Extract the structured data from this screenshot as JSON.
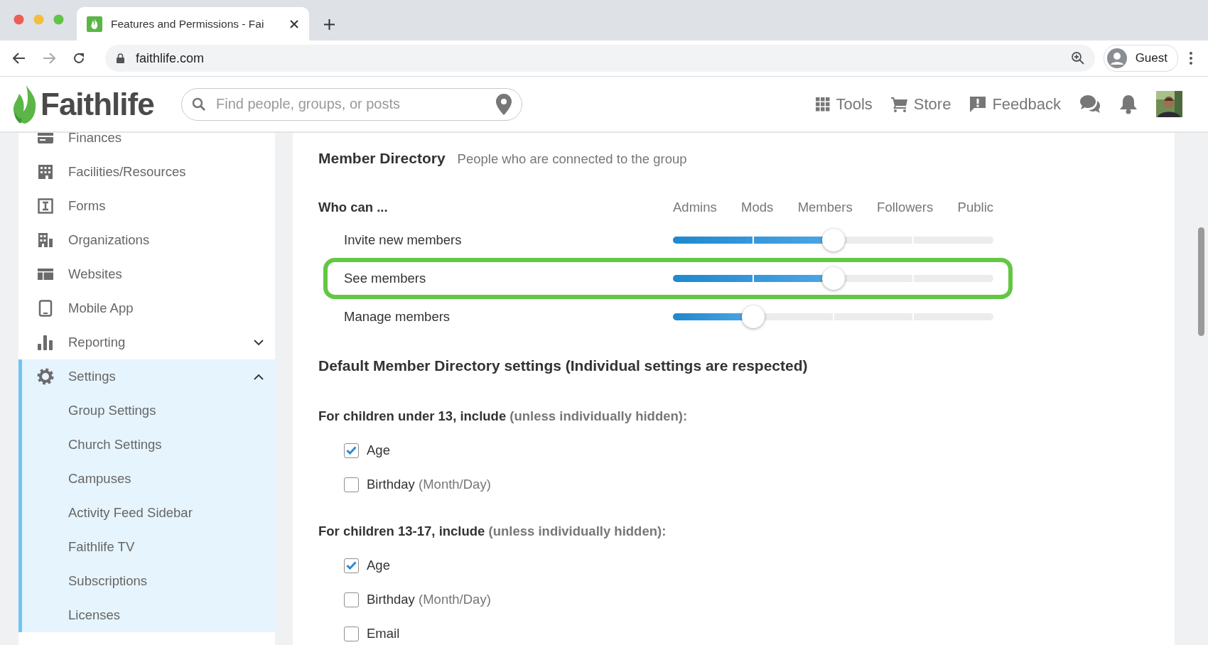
{
  "browser": {
    "tab": {
      "title": "Features and Permissions - Fai"
    },
    "url": "faithlife.com",
    "profile": "Guest"
  },
  "header": {
    "logo": "Faithlife",
    "search": {
      "placeholder": "Find people, groups, or posts"
    },
    "nav": [
      {
        "kind": "tools",
        "label": "Tools"
      },
      {
        "kind": "store",
        "label": "Store"
      },
      {
        "kind": "feedback",
        "label": "Feedback"
      }
    ]
  },
  "sidebar": {
    "items": [
      {
        "kind": "finances",
        "label": "Finances",
        "selected": false
      },
      {
        "kind": "facilities",
        "label": "Facilities/Resources",
        "selected": false
      },
      {
        "kind": "forms",
        "label": "Forms",
        "selected": false
      },
      {
        "kind": "organizations",
        "label": "Organizations",
        "selected": false
      },
      {
        "kind": "websites",
        "label": "Websites",
        "selected": false
      },
      {
        "kind": "mobile",
        "label": "Mobile App",
        "selected": false
      },
      {
        "kind": "reporting",
        "label": "Reporting",
        "selected": false,
        "expanded": false
      },
      {
        "kind": "settings",
        "label": "Settings",
        "selected": true,
        "expanded": true,
        "children": [
          {
            "label": "Group Settings",
            "selected": false
          },
          {
            "label": "Church Settings",
            "selected": false
          },
          {
            "label": "Campuses",
            "selected": false
          },
          {
            "label": "Activity Feed Sidebar",
            "selected": false
          },
          {
            "label": "Faithlife TV",
            "selected": false
          },
          {
            "label": "Subscriptions",
            "selected": false
          },
          {
            "label": "Licenses",
            "selected": false
          }
        ]
      }
    ]
  },
  "section": {
    "title": "Member Directory",
    "description": "People who are connected to the group",
    "permissions": {
      "heading": "Who can ...",
      "columns": [
        "Admins",
        "Mods",
        "Members",
        "Followers",
        "Public"
      ],
      "rows": [
        {
          "label": "Invite new members",
          "level": 0.5,
          "highlighted": false
        },
        {
          "label": "See members",
          "level": 0.5,
          "highlighted": true
        },
        {
          "label": "Manage members",
          "level": 0.25,
          "highlighted": false
        }
      ]
    }
  },
  "defaults": {
    "heading": "Default Member Directory settings (Individual settings are respected)",
    "groups": [
      {
        "title": "For children under 13, include",
        "note": "(unless individually hidden):",
        "options": [
          {
            "label": "Age",
            "checked": true
          },
          {
            "label": "Birthday",
            "note": "(Month/Day)",
            "checked": false
          }
        ]
      },
      {
        "title": "For children 13-17, include",
        "note": "(unless individually hidden):",
        "options": [
          {
            "label": "Age",
            "checked": true
          },
          {
            "label": "Birthday",
            "note": "(Month/Day)",
            "checked": false
          },
          {
            "label": "Email",
            "checked": false
          }
        ]
      }
    ]
  }
}
